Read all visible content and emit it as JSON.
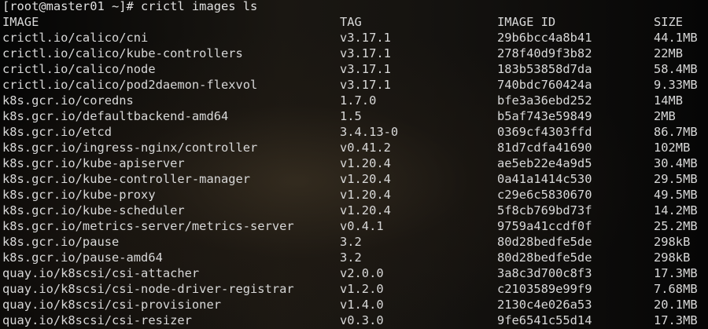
{
  "prompt": {
    "text": "[root@master01 ~]# crictl images ls"
  },
  "headers": {
    "image": "IMAGE",
    "tag": "TAG",
    "image_id": "IMAGE ID",
    "size": "SIZE"
  },
  "rows": [
    {
      "image": "crictl.io/calico/cni",
      "tag": "v3.17.1",
      "id": "29b6bcc4a8b41",
      "size": "44.1MB"
    },
    {
      "image": "crictl.io/calico/kube-controllers",
      "tag": "v3.17.1",
      "id": "278f40d9f3b82",
      "size": "22MB"
    },
    {
      "image": "crictl.io/calico/node",
      "tag": "v3.17.1",
      "id": "183b53858d7da",
      "size": "58.4MB"
    },
    {
      "image": "crictl.io/calico/pod2daemon-flexvol",
      "tag": "v3.17.1",
      "id": "740bdc760424a",
      "size": "9.33MB"
    },
    {
      "image": "k8s.gcr.io/coredns",
      "tag": "1.7.0",
      "id": "bfe3a36ebd252",
      "size": "14MB"
    },
    {
      "image": "k8s.gcr.io/defaultbackend-amd64",
      "tag": "1.5",
      "id": "b5af743e59849",
      "size": "2MB"
    },
    {
      "image": "k8s.gcr.io/etcd",
      "tag": "3.4.13-0",
      "id": "0369cf4303ffd",
      "size": "86.7MB"
    },
    {
      "image": "k8s.gcr.io/ingress-nginx/controller",
      "tag": "v0.41.2",
      "id": "81d7cdfa41690",
      "size": "102MB"
    },
    {
      "image": "k8s.gcr.io/kube-apiserver",
      "tag": "v1.20.4",
      "id": "ae5eb22e4a9d5",
      "size": "30.4MB"
    },
    {
      "image": "k8s.gcr.io/kube-controller-manager",
      "tag": "v1.20.4",
      "id": "0a41a1414c530",
      "size": "29.5MB"
    },
    {
      "image": "k8s.gcr.io/kube-proxy",
      "tag": "v1.20.4",
      "id": "c29e6c5830670",
      "size": "49.5MB"
    },
    {
      "image": "k8s.gcr.io/kube-scheduler",
      "tag": "v1.20.4",
      "id": "5f8cb769bd73f",
      "size": "14.2MB"
    },
    {
      "image": "k8s.gcr.io/metrics-server/metrics-server",
      "tag": "v0.4.1",
      "id": "9759a41ccdf0f",
      "size": "25.2MB"
    },
    {
      "image": "k8s.gcr.io/pause",
      "tag": "3.2",
      "id": "80d28bedfe5de",
      "size": "298kB"
    },
    {
      "image": "k8s.gcr.io/pause-amd64",
      "tag": "3.2",
      "id": "80d28bedfe5de",
      "size": "298kB"
    },
    {
      "image": "quay.io/k8scsi/csi-attacher",
      "tag": "v2.0.0",
      "id": "3a8c3d700c8f3",
      "size": "17.3MB"
    },
    {
      "image": "quay.io/k8scsi/csi-node-driver-registrar",
      "tag": "v1.2.0",
      "id": "c2103589e99f9",
      "size": "7.68MB"
    },
    {
      "image": "quay.io/k8scsi/csi-provisioner",
      "tag": "v1.4.0",
      "id": "2130c4e026a53",
      "size": "20.1MB"
    },
    {
      "image": "quay.io/k8scsi/csi-resizer",
      "tag": "v0.3.0",
      "id": "9fe6541c55d14",
      "size": "17.3MB"
    }
  ]
}
